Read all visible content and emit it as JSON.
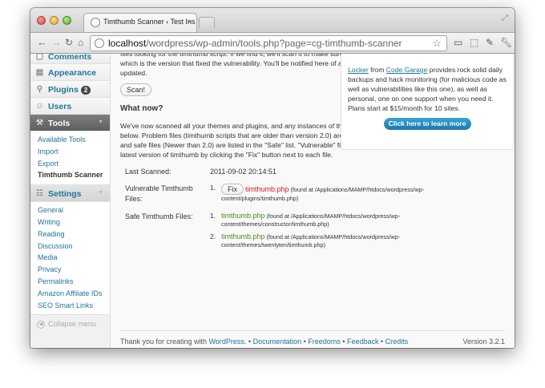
{
  "browser": {
    "tab_title": "Timthumb Scanner ‹ Test Ins",
    "tab_close": "×",
    "url_host": "localhost",
    "url_path": "/wordpress/wp-admin/tools.php?page=cg-timthumb-scanner"
  },
  "menu": {
    "comments": "Comments",
    "appearance": "Appearance",
    "plugins": "Plugins",
    "plugins_badge": "2",
    "users": "Users",
    "tools": "Tools",
    "tools_sub": [
      "Available Tools",
      "Import",
      "Export",
      "Timthumb Scanner"
    ],
    "settings": "Settings",
    "settings_sub": [
      "General",
      "Writing",
      "Reading",
      "Discussion",
      "Media",
      "Privacy",
      "Permalinks",
      "Amazon Affiliate IDs",
      "SEO Smart Links"
    ],
    "collapse": "Collapse menu"
  },
  "main": {
    "intro_partial": "files looking for the timthumb script. If we find it, we'll scan it to make sure it's at least version 2 - which is the version that fixed the vulnerability. You'll be notified here of any files that need to be updated.",
    "scan_button": "Scan!",
    "what_now_heading": "What now?",
    "what_now_text": "We've now scanned all your themes and plugins, and any instances of the timthumb script are listed below. Problem files (timthumb scripts that are older than version 2.0) are in the \"Vulnerable\" list, and safe files (Newer than 2.0) are listed in the \"Safe\" list. \"Vulnerable\" files can be upgraded to the latest version of timthumb by clicking the \"Fix\" button next to each file.",
    "last_scanned_label": "Last Scanned:",
    "last_scanned_value": "2011-09-02 20:14:51",
    "vulnerable_label": "Vulnerable Timthumb Files:",
    "fix_button": "Fix",
    "vulnerable_files": [
      {
        "num": "1.",
        "name": "timthumb.php",
        "found_at": " (found at /Applications/MAMP/htdocs/wordpress/wp-content/plugins/timthumb.php)"
      }
    ],
    "safe_label": "Safe Timthumb Files:",
    "safe_files": [
      {
        "num": "1.",
        "name": "timthumb.php",
        "found_at": " (found at /Applications/MAMP/htdocs/wordpress/wp-content/themes/constructor/timthumb.php)"
      },
      {
        "num": "2.",
        "name": "timthumb.php",
        "found_at": " (found at /Applications/MAMP/htdocs/wordpress/wp-content/themes/twentyten/timthumb.php)"
      }
    ]
  },
  "sidebox": {
    "link_locker": "Locker",
    "text_from": " from ",
    "link_garage": "Code Garage",
    "text_body": " provides rock solid daily backups and hack monitoring (for malicious code as well as vulnerabilities like this one), as well as personal, one on one support when you need it. Plans start at $15/month for 10 sites.",
    "button": "Click here to learn more"
  },
  "footer": {
    "thank_you": "Thank you for creating with ",
    "wordpress": "WordPress.",
    "sep": " • ",
    "documentation": "Documentation",
    "freedoms": "Freedoms",
    "feedback": "Feedback",
    "credits": "Credits",
    "version": "Version 3.2.1"
  }
}
